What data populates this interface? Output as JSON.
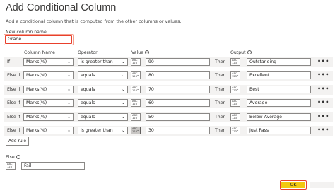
{
  "dialog": {
    "title": "Add Conditional Column",
    "subtitle": "Add a conditional column that is computed from the other columns or values."
  },
  "new_column": {
    "label": "New column name",
    "value": "Grade"
  },
  "headers": {
    "column_name": "Column Name",
    "operator": "Operator",
    "value": "Value",
    "output": "Output"
  },
  "rules": [
    {
      "keyword": "If",
      "column": "Marks(%)",
      "operator": "is greater than",
      "value": "90",
      "then": "Then",
      "output": "Outstanding",
      "more": "•••"
    },
    {
      "keyword": "Else If",
      "column": "Marks(%)",
      "operator": "equals",
      "value": "80",
      "then": "Then",
      "output": "Excellent",
      "more": "•••"
    },
    {
      "keyword": "Else If",
      "column": "Marks(%)",
      "operator": "equals",
      "value": "70",
      "then": "Then",
      "output": "Best",
      "more": "•••"
    },
    {
      "keyword": "Else If",
      "column": "Marks(%)",
      "operator": "equals",
      "value": "60",
      "then": "Then",
      "output": "Average",
      "more": "•••"
    },
    {
      "keyword": "Else If",
      "column": "Marks(%)",
      "operator": "equals",
      "value": "50",
      "then": "Then",
      "output": "Below Average",
      "more": "•••"
    },
    {
      "keyword": "Else If",
      "column": "Marks(%)",
      "operator": "is greater than",
      "value": "30",
      "then": "Then",
      "output": "Just Pass",
      "more": "•••"
    }
  ],
  "type_icon": {
    "top": "ABC",
    "mid": "123"
  },
  "add_rule_label": "Add rule",
  "else": {
    "label": "Else",
    "value": "Fail"
  },
  "buttons": {
    "ok": "OK",
    "cancel": ""
  },
  "info_glyph": "i",
  "chevron": "⌄",
  "colors": {
    "accent_yellow": "#f2c811",
    "highlight_red": "#e8402c",
    "row_band": "#f3f2f1"
  }
}
